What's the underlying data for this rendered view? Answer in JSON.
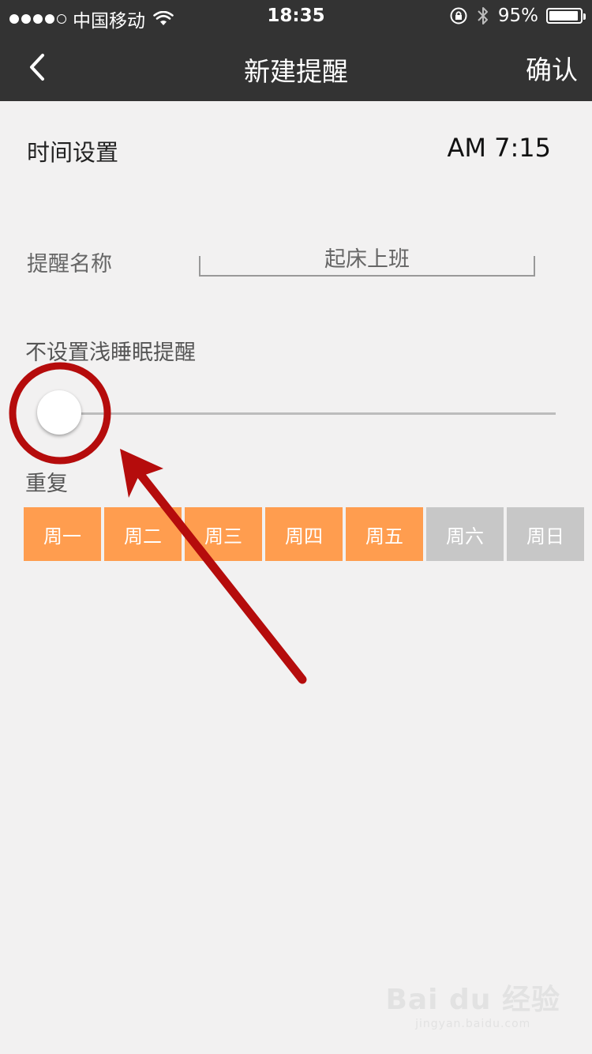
{
  "status_bar": {
    "signal_filled": 4,
    "signal_total": 5,
    "carrier": "中国移动",
    "time": "18:35",
    "battery_text": "95%",
    "battery_level": 0.95
  },
  "nav": {
    "title": "新建提醒",
    "confirm": "确认"
  },
  "time_setting": {
    "label": "时间设置",
    "value": "AM 7:15"
  },
  "reminder_name": {
    "label": "提醒名称",
    "value": "起床上班"
  },
  "light_sleep": {
    "label": "不设置浅睡眠提醒",
    "slider_value": 0
  },
  "repeat": {
    "label": "重复",
    "days": [
      {
        "label": "周一",
        "selected": true
      },
      {
        "label": "周二",
        "selected": true
      },
      {
        "label": "周三",
        "selected": true
      },
      {
        "label": "周四",
        "selected": true
      },
      {
        "label": "周五",
        "selected": true
      },
      {
        "label": "周六",
        "selected": false
      },
      {
        "label": "周日",
        "selected": false
      }
    ]
  },
  "colors": {
    "header": "#333333",
    "selected_day": "#ff9d4f",
    "unselected_day": "#c7c7c7",
    "annotation": "#b50c0c"
  },
  "watermark": {
    "logo": "Bai du 经验",
    "url": "jingyan.baidu.com"
  }
}
